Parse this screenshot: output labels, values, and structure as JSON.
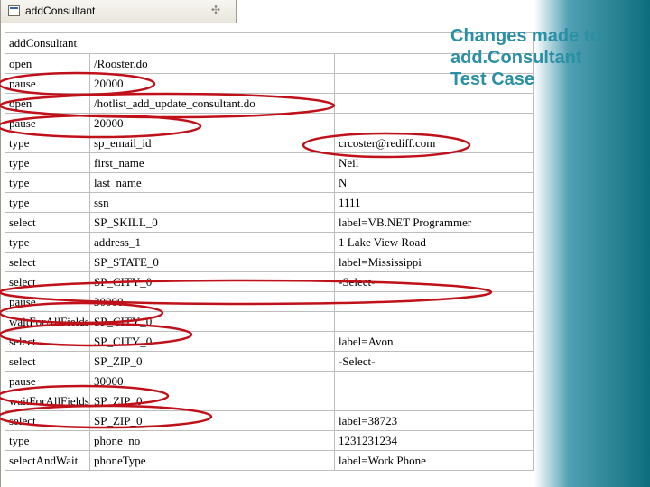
{
  "tab": {
    "title": "addConsultant",
    "pin_glyph": "✣"
  },
  "overlay": {
    "title_lines": [
      "Changes made to",
      "add.Consultant",
      "Test Case"
    ]
  },
  "table": {
    "title": "addConsultant",
    "rows": [
      [
        "open",
        "/Rooster.do",
        ""
      ],
      [
        "pause",
        "20000",
        ""
      ],
      [
        "open",
        "/hotlist_add_update_consultant.do",
        ""
      ],
      [
        "pause",
        "20000",
        ""
      ],
      [
        "type",
        "sp_email_id",
        "crcoster@rediff.com"
      ],
      [
        "type",
        "first_name",
        "Neil"
      ],
      [
        "type",
        "last_name",
        "N"
      ],
      [
        "type",
        "ssn",
        "1111"
      ],
      [
        "select",
        "SP_SKILL_0",
        "label=VB.NET Programmer"
      ],
      [
        "type",
        "address_1",
        "1 Lake View Road"
      ],
      [
        "select",
        "SP_STATE_0",
        "label=Mississippi"
      ],
      [
        "select",
        "SP_CITY_0",
        "-Select-"
      ],
      [
        "pause",
        "30000",
        ""
      ],
      [
        "waitForAllFields",
        "SP_CITY_0",
        ""
      ],
      [
        "select",
        "SP_CITY_0",
        "label=Avon"
      ],
      [
        "select",
        "SP_ZIP_0",
        "-Select-"
      ],
      [
        "pause",
        "30000",
        ""
      ],
      [
        "waitForAllFields",
        "SP_ZIP_0",
        ""
      ],
      [
        "select",
        "SP_ZIP_0",
        "label=38723"
      ],
      [
        "type",
        "phone_no",
        "1231231234"
      ],
      [
        "selectAndWait",
        "phoneType",
        "label=Work Phone"
      ]
    ]
  },
  "colors": {
    "annotation": "#c0101a",
    "overlay_text": "#2b8fa5",
    "side_panel": "#0d6d7c"
  }
}
